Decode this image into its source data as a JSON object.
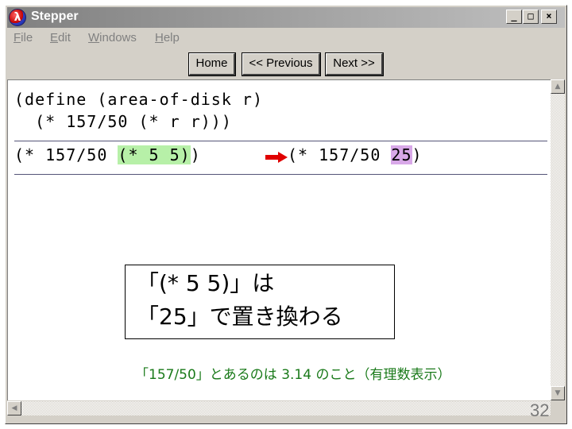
{
  "window": {
    "title": "Stepper",
    "minimize_glyph": "_",
    "maximize_glyph": "□",
    "close_glyph": "×",
    "icon_letter": "λ"
  },
  "menu": {
    "items": [
      {
        "ul": "F",
        "rest": "ile"
      },
      {
        "ul": "E",
        "rest": "dit"
      },
      {
        "ul": "W",
        "rest": "indows"
      },
      {
        "ul": "H",
        "rest": "elp"
      }
    ]
  },
  "toolbar": {
    "home_label": "Home",
    "previous_label": "<< Previous",
    "next_label": "Next >>"
  },
  "code": {
    "definition_line1": "(define (area-of-disk r)",
    "definition_line2": "  (* 157/50 (* r r)))",
    "before_prefix": "(* 157/50 ",
    "before_highlight": "(* 5 5)",
    "before_suffix": ")",
    "after_prefix": "(* 157/50 ",
    "after_highlight": "25",
    "after_suffix": ")"
  },
  "callout": {
    "line1": "「(* 5 5)」は",
    "line2": "「25」で置き換わる"
  },
  "note": "「157/50」とあるのは 3.14 のこと（有理数表示）",
  "page_number": "32",
  "colors": {
    "highlight_before": "#b7f0a8",
    "highlight_after": "#d8a8e8",
    "arrow": "#e00000",
    "note_text": "#1a7a1a"
  },
  "icons": {
    "arrow": "right-arrow-icon",
    "scroll_up": "triangle-up-icon",
    "scroll_down": "triangle-down-icon",
    "scroll_left": "triangle-left-icon"
  }
}
